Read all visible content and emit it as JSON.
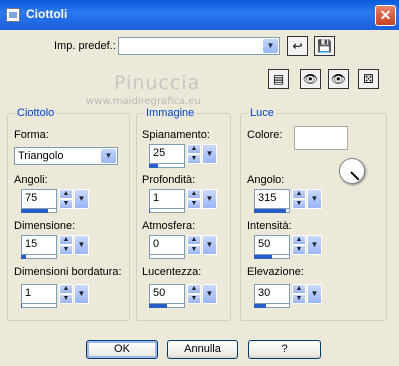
{
  "window": {
    "title": "Ciottoli"
  },
  "preset": {
    "label": "Imp. predef.:",
    "value": ""
  },
  "watermark": {
    "name": "Pinuccia",
    "url": "www.maidiregrafica.eu"
  },
  "ciottolo": {
    "legend": "Ciottolo",
    "forma_label": "Forma:",
    "forma_value": "Triangolo",
    "angoli_label": "Angoli:",
    "angoli_value": "75",
    "angoli_pct": 0.75,
    "dimensione_label": "Dimensione:",
    "dimensione_value": "15",
    "dimensione_pct": 0.15,
    "bordatura_label": "Dimensioni bordatura:",
    "bordatura_value": "1",
    "bordatura_pct": 0.01
  },
  "immagine": {
    "legend": "Immagine",
    "spianamento_label": "Spianamento:",
    "spianamento_value": "25",
    "spianamento_pct": 0.25,
    "profondita_label": "Profondità:",
    "profondita_value": "1",
    "profondita_pct": 0.01,
    "atmosfera_label": "Atmosfera:",
    "atmosfera_value": "0",
    "atmosfera_pct": 0.0,
    "lucentezza_label": "Lucentezza:",
    "lucentezza_value": "50",
    "lucentezza_pct": 0.5
  },
  "luce": {
    "legend": "Luce",
    "colore_label": "Colore:",
    "colore_value": "#ffffff",
    "angolo_label": "Angolo:",
    "angolo_value": "315",
    "angolo_pct": 0.875,
    "intensita_label": "Intensità:",
    "intensita_value": "50",
    "intensita_pct": 0.5,
    "elevazione_label": "Elevazione:",
    "elevazione_value": "30",
    "elevazione_pct": 0.33
  },
  "buttons": {
    "ok": "OK",
    "cancel": "Annulla",
    "help": "?"
  }
}
